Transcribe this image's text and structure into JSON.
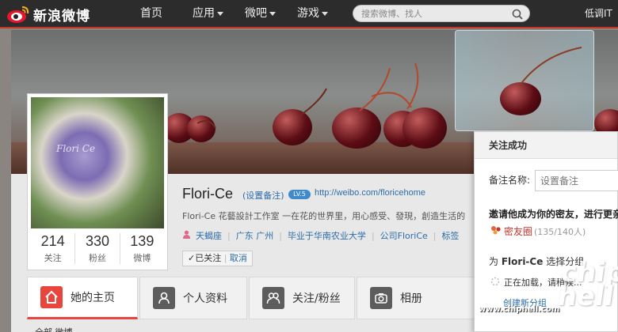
{
  "brand": {
    "name": "新浪微博"
  },
  "nav": {
    "home": "首页",
    "apps": "应用",
    "micro": "微吧",
    "games": "游戏"
  },
  "search": {
    "placeholder": "搜索微博、找人"
  },
  "user": {
    "name": "低调IT"
  },
  "profile": {
    "name": "Flori-Ce",
    "remark": "(设置备注)",
    "level_badge": "LV.5",
    "url": "http://weibo.com/floricehome",
    "bio": "Flori-Ce 花藝設計工作室 一在花的世界里，用心感受、發現，創造生活的",
    "location": "天蝎座",
    "city": "广东 广州",
    "school": "毕业于华南农业大学",
    "company": "公司FloriCe",
    "tags": "标签",
    "avatar_watermark": "Flori Ce",
    "counts": [
      {
        "n": "214",
        "l": "关注"
      },
      {
        "n": "330",
        "l": "粉丝"
      },
      {
        "n": "139",
        "l": "微博"
      }
    ],
    "follow_state": "已关注",
    "follow_cancel": "取消"
  },
  "tabs": [
    {
      "label": "她的主页"
    },
    {
      "label": "个人资料"
    },
    {
      "label": "关注/粉丝"
    },
    {
      "label": "相册"
    }
  ],
  "subnav": "全部  微博",
  "popup": {
    "title": "关注成功",
    "remark_label": "备注名称:",
    "remark_placeholder": "设置备注",
    "invite": "邀请他成为你的密友，进行更亲",
    "circle_name": "密友圈",
    "circle_capacity": "(135/140人)",
    "group_prefix": "为",
    "group_target": "Flori-Ce",
    "group_suffix": "选择分组",
    "loading": "正在加载，请稍候...",
    "new_group": "创建新分组"
  },
  "watermark": {
    "logo": "chip hell",
    "url": "www.chiphell.com"
  },
  "colors": {
    "accent_red": "#c9342a",
    "link_blue": "#2c6da8",
    "topbar": "#2c2c2c"
  }
}
